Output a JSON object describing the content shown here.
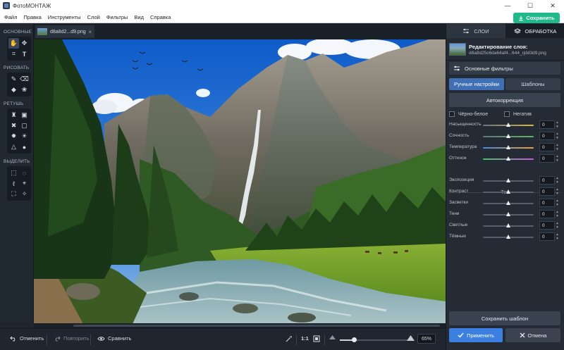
{
  "window": {
    "title": "ФотоМОНТАЖ",
    "controls": [
      "—",
      "☐",
      "✕"
    ]
  },
  "menu": [
    "Файл",
    "Правка",
    "Инструменты",
    "Слой",
    "Фильтры",
    "Вид",
    "Справка"
  ],
  "save_button": "Сохранить",
  "tools": {
    "sections": [
      "ОСНОВНЫЕ",
      "РИСОВАТЬ",
      "РЕТУШЬ",
      "ВЫДЕЛИТЬ"
    ]
  },
  "document": {
    "tab_name": "d8a8d2...d9.png",
    "close": "×"
  },
  "bottom": {
    "undo": "Отменить",
    "redo": "Повторить",
    "compare": "Сравнить",
    "ratio": "1:1",
    "zoom": "65%",
    "zoom_fraction": 0.2
  },
  "right_panel": {
    "tabs": [
      "СЛОИ",
      "ОБРАБОТКА"
    ],
    "layer_title": "Редактирование слоя:",
    "layer_file": "d8a8d25c6da64af4...644_rjdd3d9.png",
    "filters_header": "Основные фильтры",
    "mode_tabs": [
      "Ручные настройки",
      "Шаблоны"
    ],
    "autocorrect": "Автокоррекция",
    "checks": [
      "Чёрно-белое",
      "Негатив"
    ],
    "color_sliders": [
      {
        "label": "Насыщенность",
        "value": "0",
        "pos": 0.5
      },
      {
        "label": "Сочность",
        "value": "0",
        "pos": 0.5
      },
      {
        "label": "Температура",
        "value": "0",
        "pos": 0.5
      },
      {
        "label": "Оттенок",
        "value": "0",
        "pos": 0.5
      }
    ],
    "tone_title": "Тон",
    "tone_sliders": [
      {
        "label": "Экспозиция",
        "value": "0",
        "pos": 0.5
      },
      {
        "label": "Контраст",
        "value": "0",
        "pos": 0.5
      },
      {
        "label": "Засветки",
        "value": "0",
        "pos": 0.5
      },
      {
        "label": "Тени",
        "value": "0",
        "pos": 0.5
      },
      {
        "label": "Светлые",
        "value": "0",
        "pos": 0.5
      },
      {
        "label": "Тёмные",
        "value": "0",
        "pos": 0.5
      }
    ],
    "save_template": "Сохранить шаблон",
    "apply": "Применить",
    "cancel": "Отмена"
  }
}
